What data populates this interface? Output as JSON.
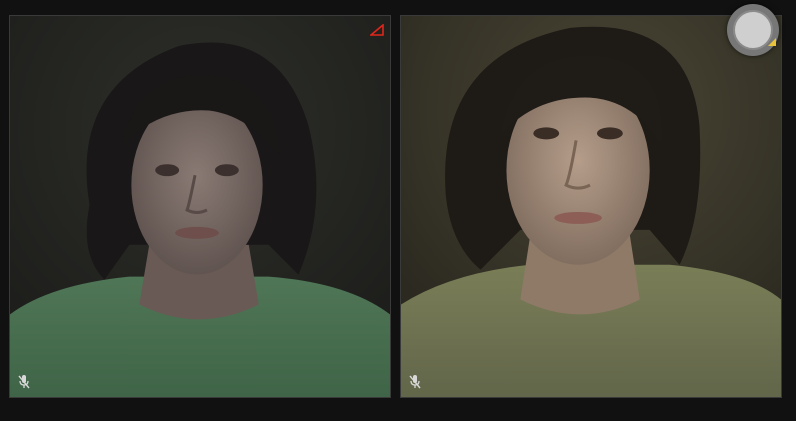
{
  "call": {
    "participants": [
      {
        "id": "remote",
        "muted": true,
        "connection_warning": true
      },
      {
        "id": "local",
        "muted": true,
        "connection_warning": false
      }
    ]
  },
  "icons": {
    "mute": "microphone-muted-icon",
    "warning": "connection-warning-icon",
    "signal": "signal-strength-icon"
  },
  "colors": {
    "background": "#111111",
    "tile_border": "#3a3a3a",
    "warning_red": "#e0261c",
    "signal_yellow": "#e8c23a",
    "mute_icon": "#d8d8d8"
  }
}
